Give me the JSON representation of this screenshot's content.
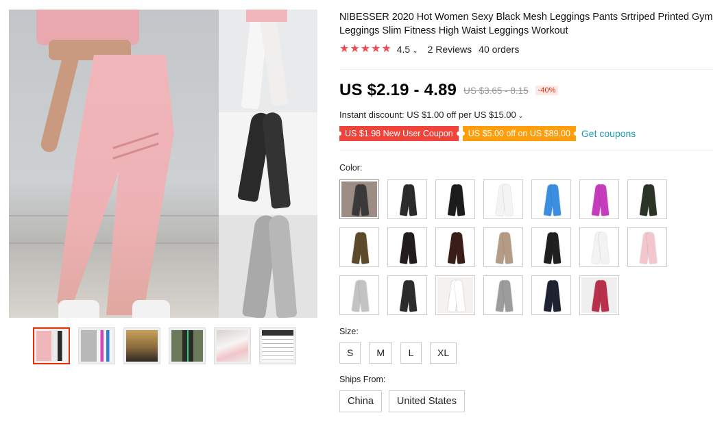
{
  "gallery": {
    "thumbnails": [
      {
        "name": "thumb-pink-black-white",
        "colors": [
          "#f0b6ba",
          "#2a2a2a",
          "#f2f2f2"
        ]
      },
      {
        "name": "thumb-multicolor",
        "colors": [
          "#b8b8b8",
          "#d645b8",
          "#2f7fd6"
        ]
      },
      {
        "name": "thumb-dark-gold",
        "colors": [
          "#8a6a3c",
          "#2e2a24",
          "#c7a15a"
        ]
      },
      {
        "name": "thumb-green-stripe",
        "colors": [
          "#3a3b30",
          "#6b7a5a",
          "#2bd08a"
        ]
      },
      {
        "name": "thumb-white-pink",
        "colors": [
          "#f2e6e6",
          "#f1c6c8",
          "#d9d2cd"
        ]
      },
      {
        "name": "thumb-size-chart",
        "colors": [
          "#ffffff",
          "#333333",
          "#bbbbbb"
        ]
      }
    ]
  },
  "product": {
    "title": "NIBESSER 2020 Hot Women Sexy Black Mesh Leggings Pants Srtriped Printed Gym Leggings Slim Fitness High Waist Leggings Workout",
    "rating": "4.5",
    "rating_chevron": "⌄",
    "reviews": "2 Reviews",
    "orders": "40 orders",
    "price": "US $2.19 - 4.89",
    "original_price": "US $3.65 - 8.15",
    "discount": "-40%",
    "instant_discount": "Instant discount: US $1.00 off per US $15.00",
    "instant_chevron": "⌄",
    "coupon_new_user": "US $1.98 New User Coupon",
    "coupon_store": "US $5.00 off on US $89.00",
    "get_coupons": "Get coupons",
    "accent_color": "#e62e04",
    "star_color": "#f44b54"
  },
  "color_section": {
    "label": "Color:",
    "swatches": [
      {
        "bg": "#9e8d84",
        "leg": "#3a3a3a"
      },
      {
        "bg": "#ffffff",
        "leg": "#2b2b2b"
      },
      {
        "bg": "#ffffff",
        "leg": "#1c1c1c"
      },
      {
        "bg": "#ffffff",
        "leg": "#f4f4f4"
      },
      {
        "bg": "#ffffff",
        "leg": "#3a8fe0"
      },
      {
        "bg": "#ffffff",
        "leg": "#c53cbd"
      },
      {
        "bg": "#ffffff",
        "leg": "#2c3327"
      },
      {
        "bg": "#ffffff",
        "leg": "#5c4a2a"
      },
      {
        "bg": "#ffffff",
        "leg": "#231c1e"
      },
      {
        "bg": "#ffffff",
        "leg": "#3a1d17"
      },
      {
        "bg": "#ffffff",
        "leg": "#b49b86"
      },
      {
        "bg": "#ffffff",
        "leg": "#1f1f1f"
      },
      {
        "bg": "#ffffff",
        "leg": "#f3f3f3"
      },
      {
        "bg": "#ffffff",
        "leg": "#f2c6cc"
      },
      {
        "bg": "#ffffff",
        "leg": "#c3c3c3"
      },
      {
        "bg": "#ffffff",
        "leg": "#2c2c2c"
      },
      {
        "bg": "#f5f1ee",
        "leg": "#ffffff"
      },
      {
        "bg": "#ffffff",
        "leg": "#9c9c9c"
      },
      {
        "bg": "#ffffff",
        "leg": "#1f2230"
      },
      {
        "bg": "#efefef",
        "leg": "#b9304b"
      }
    ]
  },
  "size_section": {
    "label": "Size:",
    "options": [
      "S",
      "M",
      "L",
      "XL"
    ]
  },
  "ships_section": {
    "label": "Ships From:",
    "options": [
      "China",
      "United States"
    ]
  }
}
